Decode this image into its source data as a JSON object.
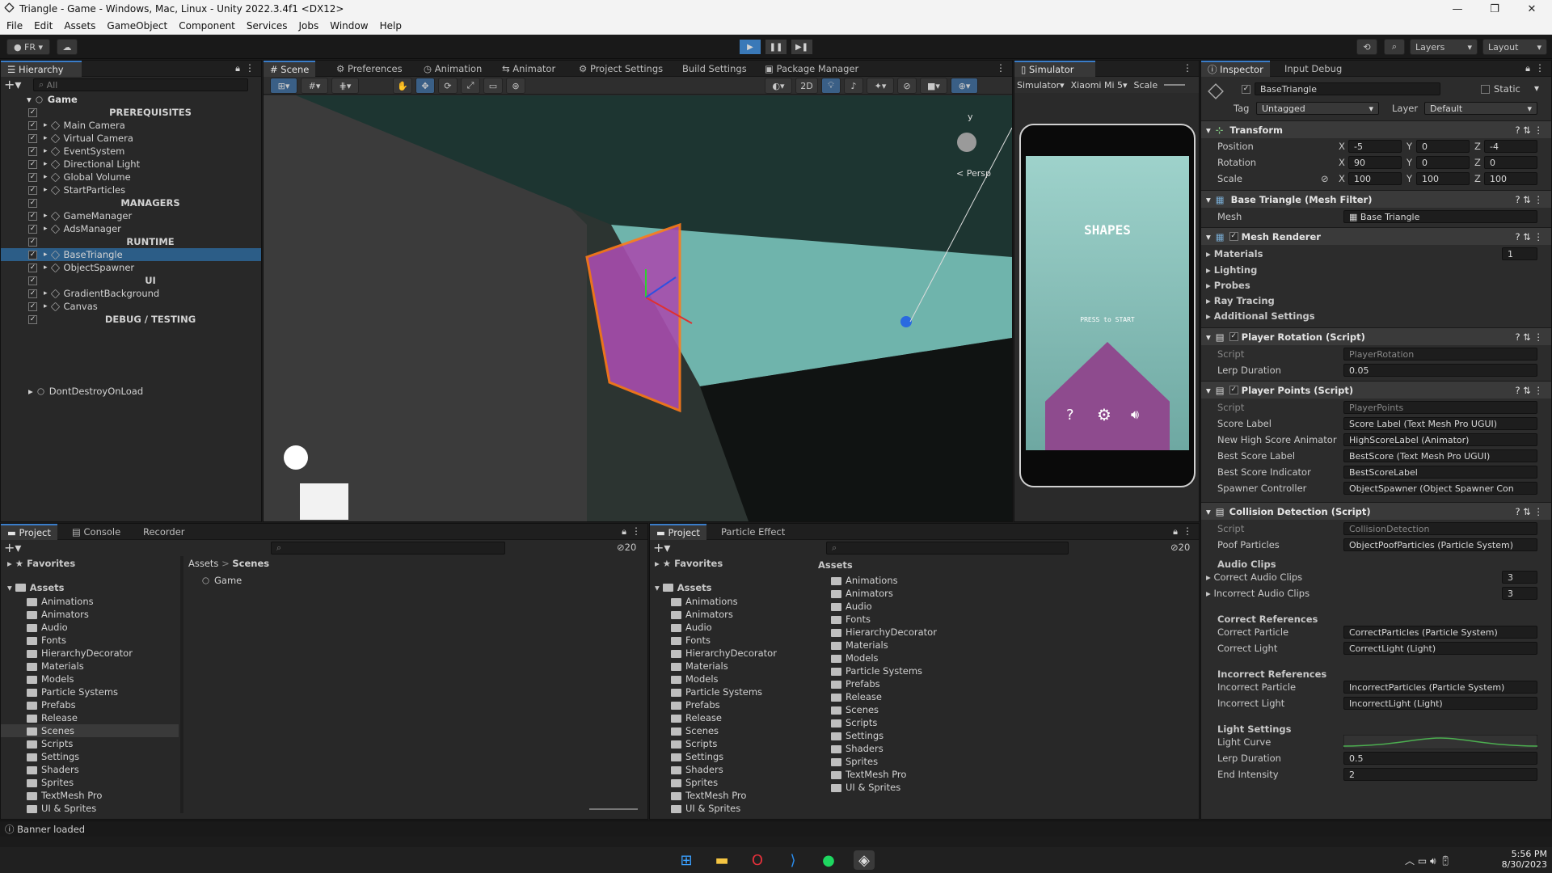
{
  "window": {
    "title": "Triangle - Game - Windows, Mac, Linux - Unity 2022.3.4f1 <DX12>"
  },
  "menu": [
    "File",
    "Edit",
    "Assets",
    "GameObject",
    "Component",
    "Services",
    "Jobs",
    "Window",
    "Help"
  ],
  "toolbar": {
    "account": "FR",
    "layers": "Layers",
    "layout": "Layout"
  },
  "hierarchy": {
    "tab": "Hierarchy",
    "search_placeholder": "All",
    "scene": "Game",
    "items": [
      {
        "type": "header",
        "label": "PREREQUISITES"
      },
      {
        "type": "obj",
        "label": "Main Camera"
      },
      {
        "type": "obj",
        "label": "Virtual Camera"
      },
      {
        "type": "obj",
        "label": "EventSystem"
      },
      {
        "type": "obj",
        "label": "Directional Light"
      },
      {
        "type": "obj",
        "label": "Global Volume"
      },
      {
        "type": "obj",
        "label": "StartParticles"
      },
      {
        "type": "header",
        "label": "MANAGERS"
      },
      {
        "type": "obj",
        "label": "GameManager"
      },
      {
        "type": "obj",
        "label": "AdsManager"
      },
      {
        "type": "header",
        "label": "RUNTIME"
      },
      {
        "type": "obj",
        "label": "BaseTriangle",
        "selected": true
      },
      {
        "type": "obj",
        "label": "ObjectSpawner"
      },
      {
        "type": "header",
        "label": "UI"
      },
      {
        "type": "obj",
        "label": "GradientBackground"
      },
      {
        "type": "obj",
        "label": "Canvas"
      },
      {
        "type": "header",
        "label": "DEBUG / TESTING"
      }
    ],
    "dontdestroy": "DontDestroyOnLoad"
  },
  "scene_tabs": [
    "Scene",
    "Preferences",
    "Animation",
    "Animator",
    "Project Settings",
    "Build Settings",
    "Package Manager"
  ],
  "scene": {
    "mode2d": "2D",
    "persp": "< Persp",
    "gizmo_y": "y"
  },
  "simulator": {
    "tab": "Simulator",
    "mode": "Simulator",
    "device": "Xiaomi Mi 5",
    "scale": "Scale",
    "game_title": "SHAPES",
    "game_prompt": "PRESS to START"
  },
  "inspector": {
    "tabs": [
      "Inspector",
      "Input Debug"
    ],
    "object_name": "BaseTriangle",
    "static": "Static",
    "tag_label": "Tag",
    "tag": "Untagged",
    "layer_label": "Layer",
    "layer": "Default",
    "transform": {
      "title": "Transform",
      "position": {
        "label": "Position",
        "x": "-5",
        "y": "0",
        "z": "-4"
      },
      "rotation": {
        "label": "Rotation",
        "x": "90",
        "y": "0",
        "z": "0"
      },
      "scale": {
        "label": "Scale",
        "x": "100",
        "y": "100",
        "z": "100"
      }
    },
    "mesh_filter": {
      "title": "Base Triangle (Mesh Filter)",
      "mesh_label": "Mesh",
      "mesh": "Base Triangle"
    },
    "mesh_renderer": {
      "title": "Mesh Renderer",
      "materials": "Materials",
      "materials_count": "1",
      "lighting": "Lighting",
      "probes": "Probes",
      "ray_tracing": "Ray Tracing",
      "additional": "Additional Settings"
    },
    "player_rotation": {
      "title": "Player Rotation (Script)",
      "script_label": "Script",
      "script": "PlayerRotation",
      "lerp_label": "Lerp Duration",
      "lerp": "0.05"
    },
    "player_points": {
      "title": "Player Points (Script)",
      "rows": [
        {
          "label": "Script",
          "value": "PlayerPoints"
        },
        {
          "label": "Score Label",
          "value": "Score Label (Text Mesh Pro UGUI)"
        },
        {
          "label": "New High Score Animator",
          "value": "HighScoreLabel (Animator)"
        },
        {
          "label": "Best Score Label",
          "value": "BestScore (Text Mesh Pro UGUI)"
        },
        {
          "label": "Best Score Indicator",
          "value": "BestScoreLabel"
        },
        {
          "label": "Spawner Controller",
          "value": "ObjectSpawner (Object Spawner Con"
        }
      ]
    },
    "collision": {
      "title": "Collision Detection (Script)",
      "script_label": "Script",
      "script": "CollisionDetection",
      "poof_label": "Poof Particles",
      "poof": "ObjectPoofParticles (Particle System)",
      "audio_header": "Audio Clips",
      "correct_audio": "Correct Audio Clips",
      "correct_audio_count": "3",
      "incorrect_audio": "Incorrect Audio Clips",
      "incorrect_audio_count": "3",
      "correct_refs": "Correct References",
      "correct_particle_label": "Correct Particle",
      "correct_particle": "CorrectParticles (Particle System)",
      "correct_light_label": "Correct Light",
      "correct_light": "CorrectLight (Light)",
      "incorrect_refs": "Incorrect References",
      "incorrect_particle_label": "Incorrect Particle",
      "incorrect_particle": "IncorrectParticles (Particle System)",
      "incorrect_light_label": "Incorrect Light",
      "incorrect_light": "IncorrectLight (Light)",
      "light_settings": "Light Settings",
      "light_curve": "Light Curve",
      "lerp_label": "Lerp Duration",
      "lerp": "0.5",
      "end_label": "End Intensity",
      "end": "2"
    }
  },
  "project_left": {
    "tabs": [
      "Project",
      "Console",
      "Recorder"
    ],
    "favorites": "Favorites",
    "assets": "Assets",
    "breadcrumb_root": "Assets",
    "breadcrumb_current": "Scenes",
    "content": [
      "Game"
    ],
    "count": "20",
    "folders": [
      "Animations",
      "Animators",
      "Audio",
      "Fonts",
      "HierarchyDecorator",
      "Materials",
      "Models",
      "Particle Systems",
      "Prefabs",
      "Release",
      "Scenes",
      "Scripts",
      "Settings",
      "Shaders",
      "Sprites",
      "TextMesh Pro",
      "UI & Sprites"
    ]
  },
  "project_right": {
    "tabs": [
      "Project",
      "Particle Effect"
    ],
    "favorites": "Favorites",
    "assets": "Assets",
    "breadcrumb": "Assets",
    "count": "20",
    "folders": [
      "Animations",
      "Animators",
      "Audio",
      "Fonts",
      "HierarchyDecorator",
      "Materials",
      "Models",
      "Particle Systems",
      "Prefabs",
      "Release",
      "Scenes",
      "Scripts",
      "Settings",
      "Shaders",
      "Sprites",
      "TextMesh Pro",
      "UI & Sprites"
    ]
  },
  "status": {
    "text": "Banner loaded"
  },
  "taskbar": {
    "time": "5:56 PM",
    "date": "8/30/2023"
  }
}
